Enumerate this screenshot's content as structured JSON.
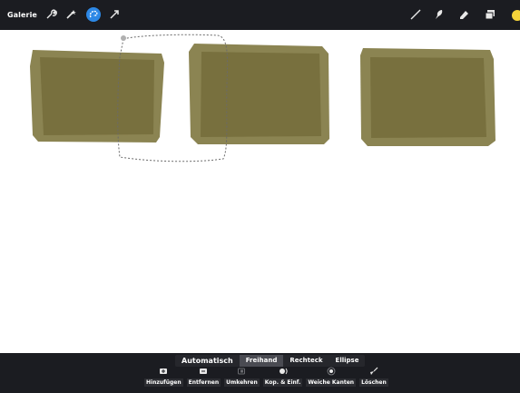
{
  "toolbar": {
    "gallery_label": "Galerie",
    "left_icons": [
      "wrench-icon",
      "magic-wand-icon",
      "selection-icon",
      "transform-icon"
    ],
    "right_icons": [
      "brush-icon",
      "smudge-icon",
      "eraser-icon",
      "layers-icon"
    ],
    "color": "#f5d33a"
  },
  "selection": {
    "modes": [
      "Automatisch",
      "Freihand",
      "Rechteck",
      "Ellipse"
    ],
    "selected_mode": "Freihand",
    "actions": [
      {
        "label": "Hinzufügen",
        "icon": "add-icon"
      },
      {
        "label": "Entfernen",
        "icon": "remove-icon"
      },
      {
        "label": "Umkehren",
        "icon": "invert-icon"
      },
      {
        "label": "Kop. & Einf.",
        "icon": "copy-paste-icon"
      },
      {
        "label": "Weiche Kanten",
        "icon": "feather-icon"
      },
      {
        "label": "Löschen",
        "icon": "clear-icon"
      }
    ]
  },
  "canvas": {
    "fill_color": "#78703e",
    "border_color": "#8b8452"
  }
}
